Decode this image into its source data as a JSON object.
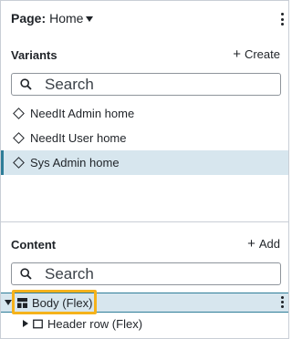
{
  "header": {
    "page_label": "Page:",
    "page_value": "Home"
  },
  "variants": {
    "title": "Variants",
    "create_label": "Create",
    "search_placeholder": "Search",
    "items": [
      {
        "label": "NeedIt Admin home",
        "selected": false
      },
      {
        "label": "NeedIt User home",
        "selected": false
      },
      {
        "label": "Sys Admin home",
        "selected": true
      }
    ]
  },
  "content": {
    "title": "Content",
    "add_label": "Add",
    "search_placeholder": "Search",
    "tree": [
      {
        "label": "Body (Flex)",
        "expanded": true,
        "selected": true
      },
      {
        "label": "Header row (Flex)",
        "expanded": false,
        "selected": false
      }
    ]
  },
  "colors": {
    "selected_bg": "#d7e6ee",
    "selected_accent": "#2e7d98",
    "highlight": "#f5b21b"
  }
}
